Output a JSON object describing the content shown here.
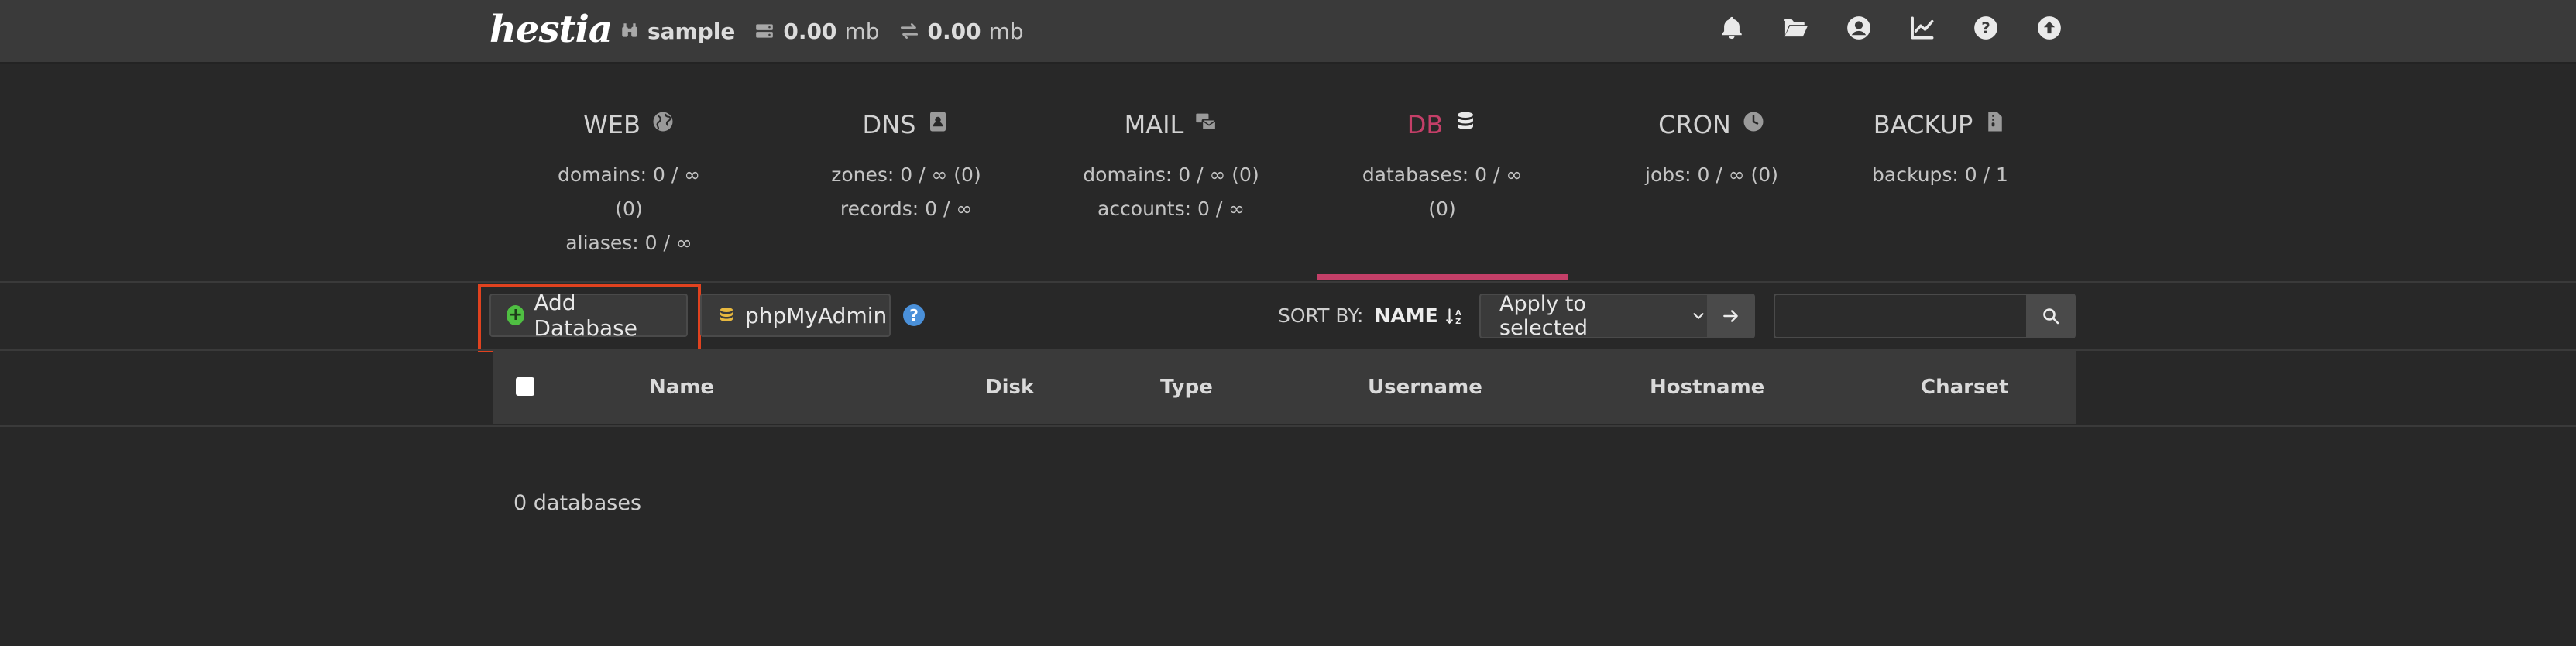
{
  "app": {
    "logo_text": "hestia",
    "user": "sample",
    "disk": {
      "value": "0.00",
      "unit": "mb"
    },
    "bandwidth": {
      "value": "0.00",
      "unit": "mb"
    },
    "top_icons": [
      "bell-icon",
      "folder-open-icon",
      "user-circle-icon",
      "chart-line-icon",
      "help-circle-icon",
      "upload-circle-icon"
    ]
  },
  "panels": [
    {
      "key": "web",
      "title": "WEB",
      "icon": "globe-icon",
      "lines": [
        "domains: 0 / ∞ (0)",
        "aliases: 0 / ∞"
      ]
    },
    {
      "key": "dns",
      "title": "DNS",
      "icon": "address-book-icon",
      "lines": [
        "zones: 0 / ∞ (0)",
        "records: 0 / ∞"
      ]
    },
    {
      "key": "mail",
      "title": "MAIL",
      "icon": "mail-bulk-icon",
      "lines": [
        "domains: 0 / ∞ (0)",
        "accounts: 0 / ∞"
      ]
    },
    {
      "key": "db",
      "title": "DB",
      "icon": "database-icon",
      "lines": [
        "databases: 0 / ∞ (0)"
      ],
      "active": true
    },
    {
      "key": "cron",
      "title": "CRON",
      "icon": "clock-icon",
      "lines": [
        "jobs: 0 / ∞ (0)"
      ]
    },
    {
      "key": "backup",
      "title": "BACKUP",
      "icon": "file-archive-icon",
      "lines": [
        "backups: 0 / 1"
      ]
    }
  ],
  "toolbar": {
    "add_label": "Add Database",
    "pma_label": "phpMyAdmin",
    "help_symbol": "?",
    "sort_label": "SORT BY:",
    "sort_value": "NAME",
    "apply_label": "Apply to selected",
    "search_placeholder": ""
  },
  "table": {
    "columns": [
      "Name",
      "Disk",
      "Type",
      "Username",
      "Hostname",
      "Charset"
    ]
  },
  "footer": {
    "count": "0 databases"
  },
  "colors": {
    "accent": "#c43f68",
    "highlight": "#e0421f",
    "topbar": "#3a3a3a",
    "background": "#282828"
  }
}
